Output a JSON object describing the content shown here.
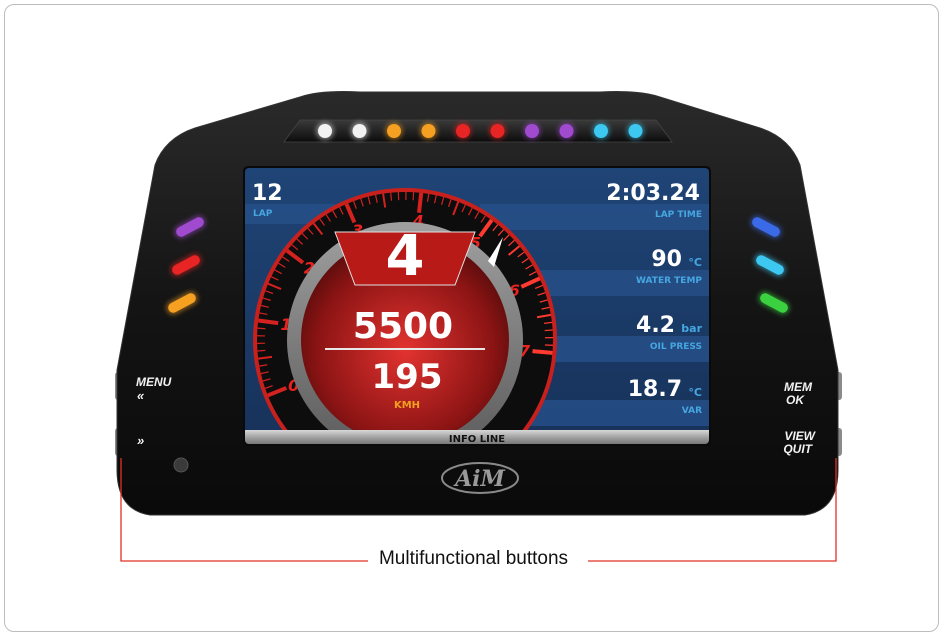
{
  "colors": {
    "body": "#121212",
    "screen_bg": "#1c3a66",
    "row_light": "#27508a",
    "label_blue": "#46a6e0",
    "accent_red": "#e0201f",
    "callout_line": "#e03025"
  },
  "shift_leds": [
    "white",
    "white",
    "orange",
    "orange",
    "red",
    "red",
    "purple",
    "purple",
    "cyan",
    "cyan"
  ],
  "side_leds_left": [
    "purple",
    "red",
    "orange"
  ],
  "side_leds_right": [
    "blue",
    "cyan",
    "green"
  ],
  "screen": {
    "lap_value": "12",
    "lap_label": "LAP",
    "gear": "4",
    "rpm": "5500",
    "speed": "195",
    "speed_unit": "KMH",
    "gauge_ticks": [
      "0",
      "1",
      "2",
      "3",
      "4",
      "5",
      "6",
      "7"
    ],
    "info_line": "INFO LINE",
    "fields": [
      {
        "value": "2:03.24",
        "unit": "",
        "label": "LAP TIME"
      },
      {
        "value": "90",
        "unit": "°C",
        "label": "WATER TEMP"
      },
      {
        "value": "4.2",
        "unit": "bar",
        "label": "OIL PRESS"
      },
      {
        "value": "18.7",
        "unit": "°C",
        "label": "VAR"
      }
    ]
  },
  "buttons": {
    "menu_label": "MENU",
    "menu_arrows": "«",
    "next_arrows": "»",
    "mem_label": "MEM",
    "ok_label": "OK",
    "view_label": "VIEW",
    "quit_label": "QUIT"
  },
  "logo_text": "AiM",
  "callout_label": "Multifunctional buttons"
}
